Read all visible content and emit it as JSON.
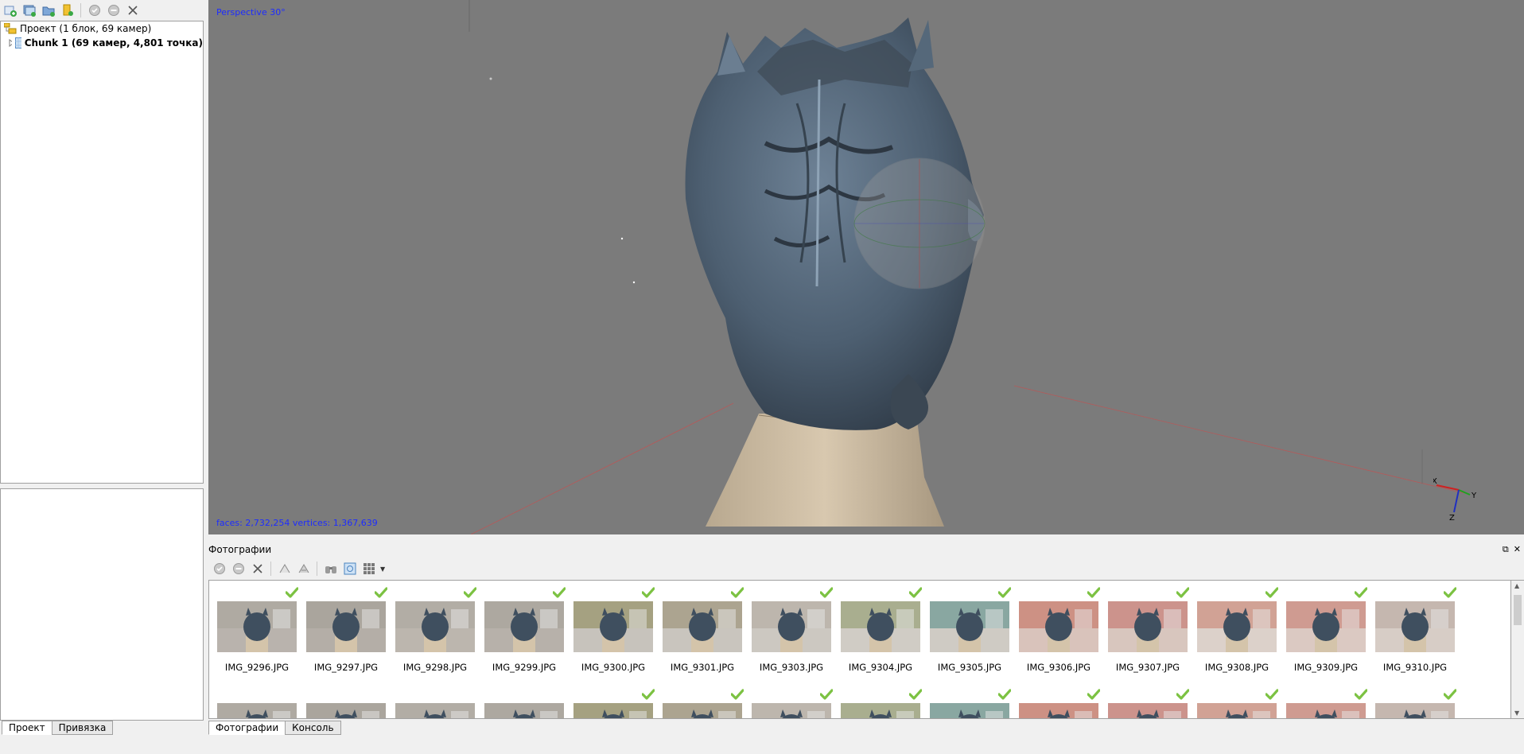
{
  "left_panel": {
    "toolbar": [
      {
        "icon": "add-chunk-icon"
      },
      {
        "icon": "add-photos-icon"
      },
      {
        "icon": "add-folder-icon"
      },
      {
        "icon": "add-markers-icon"
      },
      {
        "icon": "enable-icon"
      },
      {
        "icon": "disable-icon"
      },
      {
        "icon": "delete-icon"
      }
    ],
    "tree": {
      "root_label": "Проект (1 блок, 69 камер)",
      "chunk_label": "Chunk 1 (69 камер, 4,801 точка)"
    },
    "tabs": [
      "Проект",
      "Привязка"
    ]
  },
  "viewport": {
    "projection_label": "Perspective 30°",
    "stats_label": "faces: 2,732,254 vertices: 1,367,639",
    "axes": {
      "x": "X",
      "y": "Y",
      "z": "Z"
    }
  },
  "photos_panel": {
    "title": "Фотографии",
    "window_buttons": [
      "⧉",
      "✕"
    ],
    "toolbar": [
      {
        "icon": "enable-icon"
      },
      {
        "icon": "disable-icon"
      },
      {
        "icon": "delete-icon"
      },
      {
        "icon": "rotate-left-icon"
      },
      {
        "icon": "rotate-right-icon"
      },
      {
        "icon": "binoculars-icon"
      },
      {
        "icon": "reset-filter-icon"
      },
      {
        "icon": "view-mode-icon"
      }
    ],
    "photos": [
      {
        "name": "IMG_9296.JPG",
        "bg": "#b9b3ad",
        "wall": "#a9a39b"
      },
      {
        "name": "IMG_9297.JPG",
        "bg": "#b4aea7",
        "wall": "#a49e96"
      },
      {
        "name": "IMG_9298.JPG",
        "bg": "#bcb6ae",
        "wall": "#aca69e"
      },
      {
        "name": "IMG_9299.JPG",
        "bg": "#b7b1aa",
        "wall": "#a7a199"
      },
      {
        "name": "IMG_9300.JPG",
        "bg": "#c7c3bc",
        "wall": "#8d8a5a"
      },
      {
        "name": "IMG_9301.JPG",
        "bg": "#c9c5be",
        "wall": "#9a8d72"
      },
      {
        "name": "IMG_9303.JPG",
        "bg": "#ccc8c1",
        "wall": "#b3aaa0"
      },
      {
        "name": "IMG_9304.JPG",
        "bg": "#d0ccc5",
        "wall": "#8f9a6a"
      },
      {
        "name": "IMG_9305.JPG",
        "bg": "#cfcbc4",
        "wall": "#5a8f8a"
      },
      {
        "name": "IMG_9306.JPG",
        "bg": "#d9c3bb",
        "wall": "#c46f5f"
      },
      {
        "name": "IMG_9307.JPG",
        "bg": "#d8c6be",
        "wall": "#c4726a"
      },
      {
        "name": "IMG_9308.JPG",
        "bg": "#dcd1ca",
        "wall": "#c98272"
      },
      {
        "name": "IMG_9309.JPG",
        "bg": "#dbc9c2",
        "wall": "#c77d70"
      },
      {
        "name": "IMG_9310.JPG",
        "bg": "#d7cdc6",
        "wall": "#b9a8a0"
      }
    ],
    "second_row_checks": [
      false,
      false,
      false,
      false,
      true,
      true,
      true,
      true,
      true,
      true,
      true,
      true,
      true,
      true
    ]
  },
  "bottom_tabs": [
    "Фотографии",
    "Консоль"
  ],
  "colors": {
    "viewport_bg": "#7b7b7b",
    "overlay_text": "#1d2cff",
    "model": "#4f6173",
    "base": "#cdbba2",
    "check": "#7cc242"
  }
}
